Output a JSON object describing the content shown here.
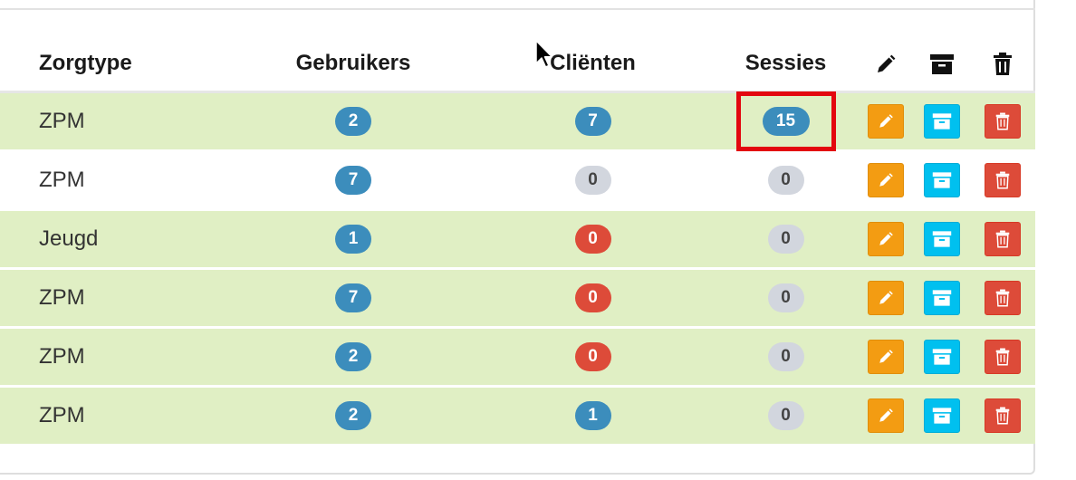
{
  "columns": {
    "zorgtype": "Zorgtype",
    "gebruikers": "Gebruikers",
    "clienten": "Cliënten",
    "sessies": "Sessies",
    "edit_icon": "pencil-icon",
    "archive_icon": "archive-icon",
    "delete_icon": "trash-icon"
  },
  "rows": [
    {
      "zorgtype": "ZPM",
      "gebruikers": "2",
      "clienten": "7",
      "sessies": "15"
    },
    {
      "zorgtype": "ZPM",
      "gebruikers": "7",
      "clienten": "0",
      "sessies": "0"
    },
    {
      "zorgtype": "Jeugd",
      "gebruikers": "1",
      "clienten": "0",
      "sessies": "0"
    },
    {
      "zorgtype": "ZPM",
      "gebruikers": "7",
      "clienten": "0",
      "sessies": "0"
    },
    {
      "zorgtype": "ZPM",
      "gebruikers": "2",
      "clienten": "0",
      "sessies": "0"
    },
    {
      "zorgtype": "ZPM",
      "gebruikers": "2",
      "clienten": "1",
      "sessies": "0"
    }
  ],
  "colors": {
    "row_green": "#e0efc4",
    "badge_blue": "#3c8dbc",
    "badge_red": "#dd4b39",
    "badge_grey": "#d2d6de",
    "btn_edit": "#f39c12",
    "btn_archive": "#00c0ef",
    "btn_delete": "#dd4b39",
    "highlight": "#e3070f"
  }
}
